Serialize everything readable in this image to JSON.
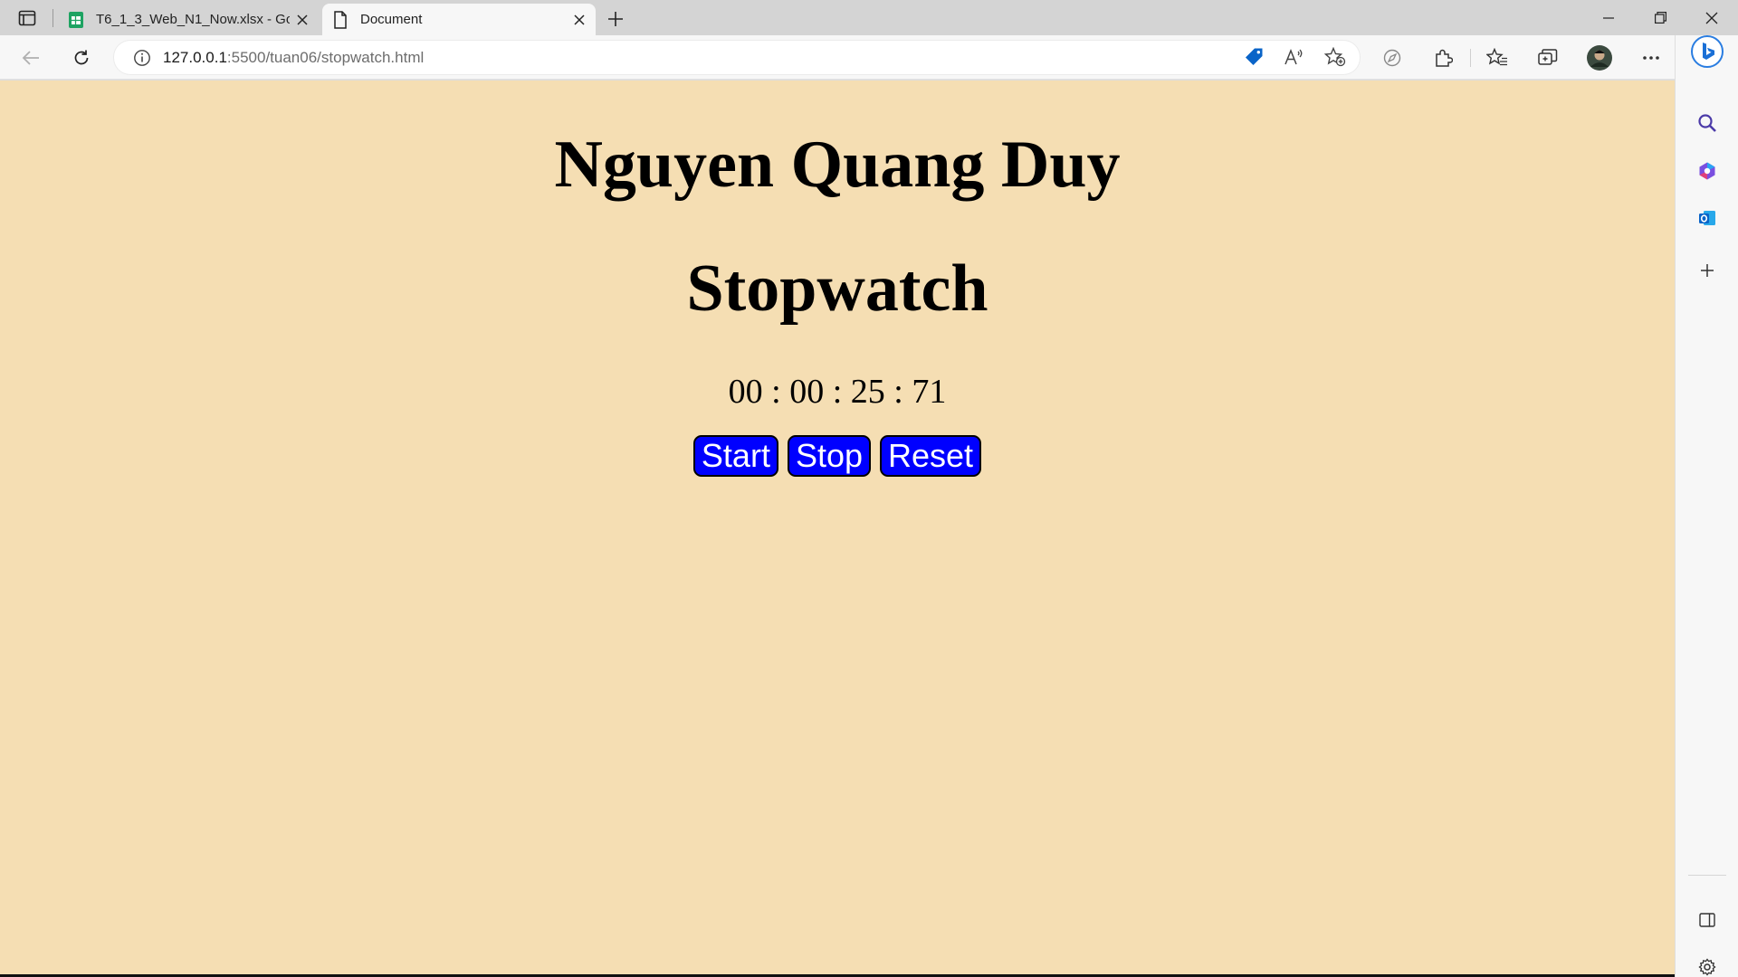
{
  "browser": {
    "tabs": [
      {
        "title": "T6_1_3_Web_N1_Now.xlsx - Goo",
        "icon": "sheets-icon",
        "active": false
      },
      {
        "title": "Document",
        "icon": "document-icon",
        "active": true
      }
    ],
    "address": {
      "host": "127.0.0.1",
      "path": ":5500/tuan06/stopwatch.html"
    },
    "colors": {
      "accent": "#0078d4"
    }
  },
  "page": {
    "name_heading": "Nguyen Quang Duy",
    "title_heading": "Stopwatch",
    "timer": "00 : 00 : 25 : 71",
    "buttons": {
      "start": "Start",
      "stop": "Stop",
      "reset": "Reset"
    },
    "colors": {
      "background": "#f5deb3",
      "button": "#0000ff",
      "button_text": "#ffffff"
    }
  }
}
